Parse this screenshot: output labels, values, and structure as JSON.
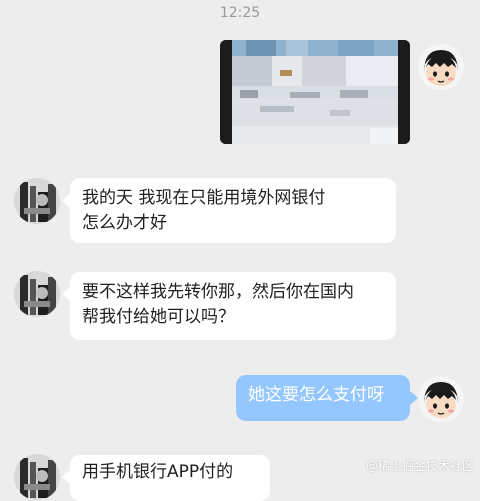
{
  "status": {
    "time": "12:25"
  },
  "chat": {
    "messages": [
      {
        "sender": "self",
        "type": "image",
        "alt": ""
      },
      {
        "sender": "other",
        "type": "text",
        "text": "我的天 我现在只能用境外网银付\n怎么办才好"
      },
      {
        "sender": "other",
        "type": "text",
        "text": "要不这样我先转你那，然后你在国内\n帮我付给她可以吗？"
      },
      {
        "sender": "self",
        "type": "text",
        "text": "她这要怎么支付呀"
      },
      {
        "sender": "other",
        "type": "text",
        "text": "用手机银行APP付的"
      }
    ]
  },
  "watermark": "@稀土掘金技术社区",
  "colors": {
    "background": "#ededed",
    "self_bubble": "#95c7ff",
    "other_bubble": "#ffffff"
  },
  "icons": {
    "self_avatar": "cartoon-girl-avatar-icon",
    "other_avatar": "photo-avatar-icon"
  }
}
